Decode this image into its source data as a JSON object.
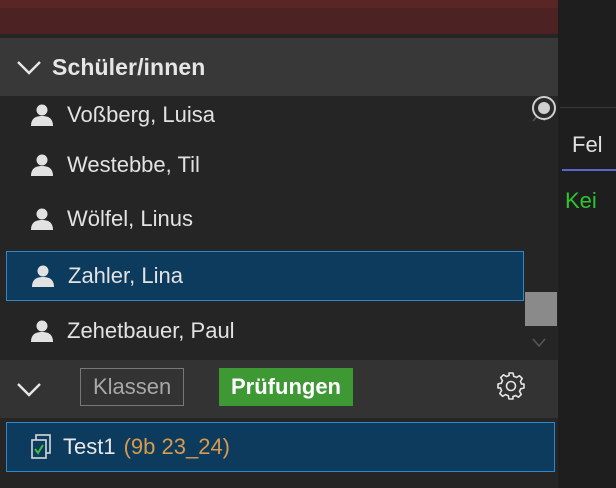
{
  "colors": {
    "background": "#252526",
    "selection_bg": "#0c3b5e",
    "selection_border": "#2f87c8",
    "active_tab": "#3e9935",
    "class_label": "#d99a4a",
    "status_green": "#2ec42e"
  },
  "students_section": {
    "title": "Schüler/innen",
    "icon": "chevron-down-icon"
  },
  "students": [
    {
      "name": "Voßberg, Luisa",
      "icon": "person-icon",
      "selected": false
    },
    {
      "name": "Westebbe, Til",
      "icon": "person-icon",
      "selected": false
    },
    {
      "name": "Wölfel, Linus",
      "icon": "person-icon",
      "selected": false
    },
    {
      "name": "Zahler, Lina",
      "icon": "person-icon",
      "selected": true
    },
    {
      "name": "Zehetbauer, Paul",
      "icon": "person-icon",
      "selected": false
    }
  ],
  "tabs": {
    "klassen": "Klassen",
    "pruefungen": "Prüfungen",
    "active": "pruefungen",
    "settings_icon": "gear-icon"
  },
  "exams": [
    {
      "name": "Test1",
      "class": "(9b 23_24)",
      "icon": "exam-check-icon",
      "selected": true
    }
  ],
  "right_panel": {
    "tab_label": "Fel",
    "status_text": "Kei"
  }
}
